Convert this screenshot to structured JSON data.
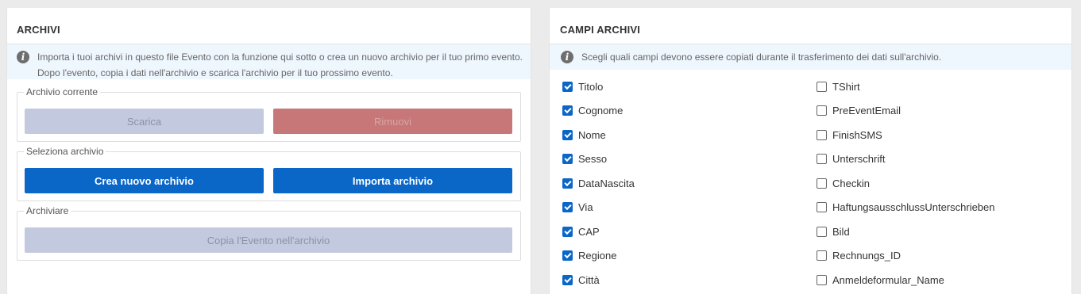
{
  "archivi": {
    "title": "ARCHIVI",
    "info": "Importa i tuoi archivi in questo file Evento con la funzione qui sotto o crea un nuovo archivio per il tuo primo evento. Dopo l'evento, copia i dati nell'archivio e scarica l'archivio per il tuo prossimo evento.",
    "current": {
      "legend": "Archivio corrente",
      "download_label": "Scarica",
      "remove_label": "Rimuovi"
    },
    "select": {
      "legend": "Seleziona archivio",
      "create_label": "Crea nuovo archivio",
      "import_label": "Importa archivio"
    },
    "archive": {
      "legend": "Archiviare",
      "copy_label": "Copia l'Evento nell'archivio"
    }
  },
  "campi": {
    "title": "CAMPI ARCHIVI",
    "info": "Scegli quali campi devono essere copiati durante il trasferimento dei dati sull'archivio.",
    "fields": [
      {
        "label": "Titolo",
        "checked": true
      },
      {
        "label": "Cognome",
        "checked": true
      },
      {
        "label": "Nome",
        "checked": true
      },
      {
        "label": "Sesso",
        "checked": true
      },
      {
        "label": "DataNascita",
        "checked": true
      },
      {
        "label": "Via",
        "checked": true
      },
      {
        "label": "CAP",
        "checked": true
      },
      {
        "label": "Regione",
        "checked": true
      },
      {
        "label": "Città",
        "checked": true
      },
      {
        "label": "TShirt",
        "checked": false
      },
      {
        "label": "PreEventEmail",
        "checked": false
      },
      {
        "label": "FinishSMS",
        "checked": false
      },
      {
        "label": "Unterschrift",
        "checked": false
      },
      {
        "label": "Checkin",
        "checked": false
      },
      {
        "label": "HaftungsausschlussUnterschrieben",
        "checked": false
      },
      {
        "label": "Bild",
        "checked": false
      },
      {
        "label": "Rechnungs_ID",
        "checked": false
      },
      {
        "label": "Anmeldeformular_Name",
        "checked": false
      }
    ]
  },
  "colors": {
    "primary": "#0a66c7",
    "danger_disabled": "#c77777",
    "disabled": "#c3cadf",
    "info_bg": "#eef6fe"
  }
}
